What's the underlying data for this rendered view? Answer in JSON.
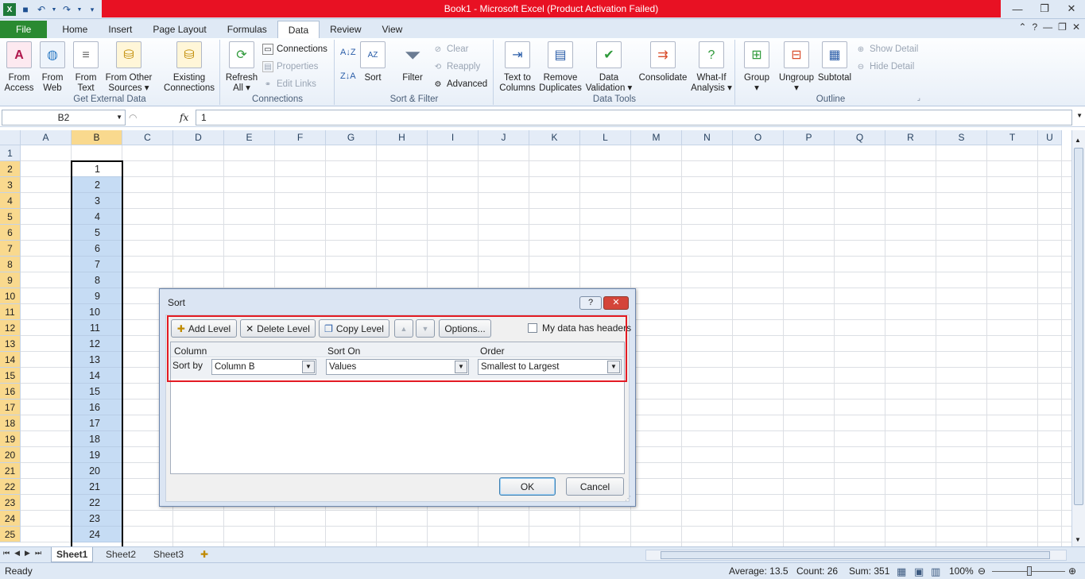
{
  "title_bar": {
    "title": "Book1  -  Microsoft Excel (Product Activation Failed)",
    "qat_icons": [
      "excel-logo-icon",
      "save-icon",
      "undo-icon",
      "redo-icon",
      "customize-qat-icon"
    ]
  },
  "tabs": [
    "File",
    "Home",
    "Insert",
    "Page Layout",
    "Formulas",
    "Data",
    "Review",
    "View"
  ],
  "active_tab": "Data",
  "ribbon": {
    "get_external_data": {
      "label": "Get External Data",
      "buttons": [
        {
          "line1": "From",
          "line2": "Access"
        },
        {
          "line1": "From",
          "line2": "Web"
        },
        {
          "line1": "From",
          "line2": "Text"
        },
        {
          "line1": "From Other",
          "line2": "Sources ▾"
        },
        {
          "line1": "Existing",
          "line2": "Connections"
        }
      ]
    },
    "connections": {
      "label": "Connections",
      "refresh_line1": "Refresh",
      "refresh_line2": "All ▾",
      "connections": "Connections",
      "properties": "Properties",
      "edit_links": "Edit Links"
    },
    "sort_filter": {
      "label": "Sort & Filter",
      "sort": "Sort",
      "filter": "Filter",
      "clear": "Clear",
      "reapply": "Reapply",
      "advanced": "Advanced"
    },
    "data_tools": {
      "label": "Data Tools",
      "buttons": [
        {
          "line1": "Text to",
          "line2": "Columns"
        },
        {
          "line1": "Remove",
          "line2": "Duplicates"
        },
        {
          "line1": "Data",
          "line2": "Validation ▾"
        },
        {
          "line1": "Consolidate",
          "line2": ""
        },
        {
          "line1": "What-If",
          "line2": "Analysis ▾"
        }
      ]
    },
    "outline": {
      "label": "Outline",
      "group": "Group",
      "ungroup": "Ungroup",
      "subtotal": "Subtotal",
      "show_detail": "Show Detail",
      "hide_detail": "Hide Detail"
    }
  },
  "formula_bar": {
    "name_box": "B2",
    "fx": "fx",
    "value": "1"
  },
  "columns": [
    "A",
    "B",
    "C",
    "D",
    "E",
    "F",
    "G",
    "H",
    "I",
    "J",
    "K",
    "L",
    "M",
    "N",
    "O",
    "P",
    "Q",
    "R",
    "S",
    "T",
    "U"
  ],
  "rows": [
    "1",
    "2",
    "3",
    "4",
    "5",
    "6",
    "7",
    "8",
    "9",
    "10",
    "11",
    "12",
    "13",
    "14",
    "15",
    "16",
    "17",
    "18",
    "19",
    "20",
    "21",
    "22",
    "23",
    "24",
    "25"
  ],
  "column_b_values": [
    "1",
    "2",
    "3",
    "4",
    "5",
    "6",
    "7",
    "8",
    "9",
    "10",
    "11",
    "12",
    "13",
    "14",
    "15",
    "16",
    "17",
    "18",
    "19",
    "20",
    "21",
    "22",
    "23",
    "24"
  ],
  "sheets": [
    "Sheet1",
    "Sheet2",
    "Sheet3"
  ],
  "status": {
    "mode": "Ready",
    "average": "Average: 13.5",
    "count": "Count: 26",
    "sum": "Sum: 351",
    "zoom": "100%"
  },
  "sort_dialog": {
    "title": "Sort",
    "help": "?",
    "close": "✕",
    "add_level": "Add Level",
    "delete_level": "Delete Level",
    "copy_level": "Copy Level",
    "options": "Options...",
    "headers_checkbox": "My data has headers",
    "headers_checked": false,
    "col_header": "Column",
    "sort_on_header": "Sort On",
    "order_header": "Order",
    "sort_by_label": "Sort by",
    "column_value": "Column B",
    "sort_on_value": "Values",
    "order_value": "Smallest to Largest",
    "ok": "OK",
    "cancel": "Cancel"
  }
}
